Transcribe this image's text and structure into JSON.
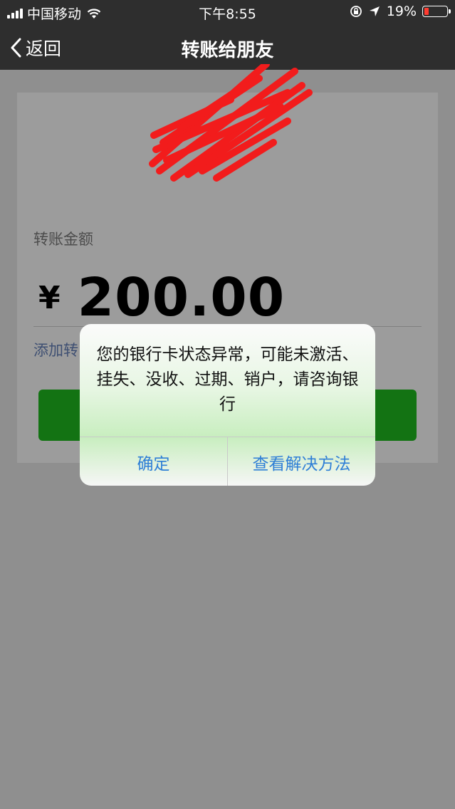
{
  "status_bar": {
    "carrier": "中国移动",
    "time": "下午8:55",
    "battery_percent": "19%",
    "battery_level": 0.19,
    "icons": [
      "signal-icon",
      "wifi-icon",
      "rotation-lock-icon",
      "location-icon",
      "battery-icon"
    ]
  },
  "nav": {
    "back_label": "返回",
    "title": "转账给朋友"
  },
  "form": {
    "amount_label": "转账金额",
    "currency": "¥",
    "amount": "200.00",
    "add_note_label": "添加转"
  },
  "alert": {
    "message": "您的银行卡状态异常，可能未激活、挂失、没收、过期、销户，请咨询银行",
    "confirm_label": "确定",
    "solution_label": "查看解决方法"
  },
  "colors": {
    "nav_bg": "#2e2e2e",
    "button_green": "#137313",
    "alert_link": "#2f7fd6",
    "redaction": "#f21c1c"
  }
}
